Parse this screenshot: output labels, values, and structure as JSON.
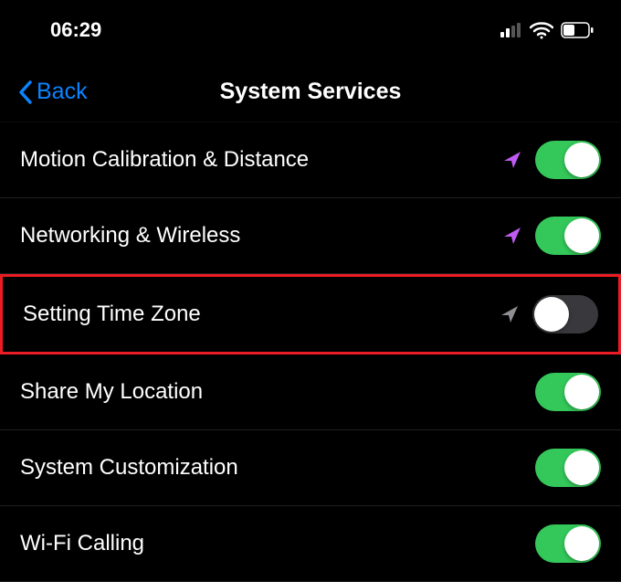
{
  "status_bar": {
    "time": "06:29"
  },
  "nav": {
    "back_label": "Back",
    "title": "System Services"
  },
  "rows": [
    {
      "label": "Motion Calibration & Distance",
      "indicator": "purple",
      "toggle": true,
      "highlighted": false
    },
    {
      "label": "Networking & Wireless",
      "indicator": "purple",
      "toggle": true,
      "highlighted": false
    },
    {
      "label": "Setting Time Zone",
      "indicator": "gray",
      "toggle": false,
      "highlighted": true
    },
    {
      "label": "Share My Location",
      "indicator": null,
      "toggle": true,
      "highlighted": false
    },
    {
      "label": "System Customization",
      "indicator": null,
      "toggle": true,
      "highlighted": false
    },
    {
      "label": "Wi-Fi Calling",
      "indicator": null,
      "toggle": true,
      "highlighted": false
    }
  ],
  "colors": {
    "accent_blue": "#0a84ff",
    "toggle_green": "#34c759",
    "indicator_purple": "#bf5af2",
    "indicator_gray": "#8e8e93",
    "highlight_red": "#ed1c24"
  }
}
